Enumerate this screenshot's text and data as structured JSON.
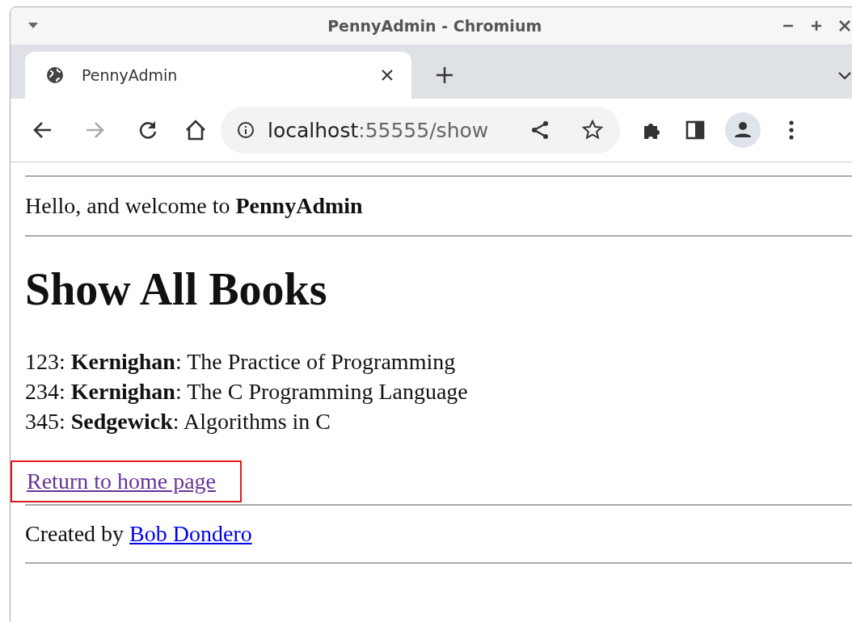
{
  "window": {
    "title": "PennyAdmin - Chromium"
  },
  "tabs": [
    {
      "title": "PennyAdmin",
      "selected": true
    }
  ],
  "address_bar": {
    "host": "localhost",
    "path": ":55555/show"
  },
  "page": {
    "greeting": "Hello, and welcome to **PennyAdmin**",
    "heading": "Show All Books",
    "books": [
      "123: **Kernighan**: The Practice of Programming",
      "234: **Kernighan**: The C Programming Language",
      "345: **Sedgewick**: Algorithms in C"
    ],
    "return_link": {
      "text": "Return to home page",
      "visited": true,
      "highlighted": true
    },
    "footer": {
      "prefix": "Created by",
      "link": "Bob Dondero",
      "visited": false
    }
  }
}
